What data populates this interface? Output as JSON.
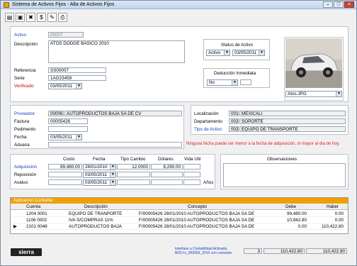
{
  "window": {
    "title": "Sistema de Activos Fijos - Alta de Activos Fijos"
  },
  "toolbar": {
    "icons": [
      "new-icon",
      "save-icon",
      "delete-icon",
      "money-icon",
      "edit-icon",
      "print-icon"
    ]
  },
  "asset": {
    "activo_label": "Activo",
    "activo_value": "00007",
    "descripcion_label": "Descripción",
    "descripcion_value": "ATOS DODGE BASICO 2010",
    "referencia_label": "Referencia",
    "referencia_value": "SS00007",
    "serie_label": "Serie",
    "serie_value": "1AG23459",
    "verificado_label": "Verificado",
    "verificado_value": "03/05/2011"
  },
  "status": {
    "title": "Status de Activo",
    "value": "Activo",
    "date": "03/05/2011"
  },
  "deduccion": {
    "title": "Deducción Inmediata",
    "value": "No"
  },
  "photo": {
    "file": "Atos.JPG"
  },
  "proveedor": {
    "proveedor_label": "Proveedor",
    "proveedor_code": "00006",
    "proveedor_name": "AUTOPRODUCTOS BAJA SA DE CV",
    "factura_label": "Factura",
    "factura_value": "00005426",
    "pedimento_label": "Pedimento",
    "pedimento_value": "",
    "fecha_label": "Fecha",
    "fecha_value": "03/05/2011",
    "aduana_label": "Aduana",
    "aduana_value": ""
  },
  "location": {
    "localizacion_label": "Localización",
    "localizacion_code": "001",
    "localizacion_name": "MEXICALI",
    "departamento_label": "Departamento",
    "departamento_code": "002",
    "departamento_name": "SOPORTE",
    "tipo_label": "Tipo de Activo",
    "tipo_code": "002",
    "tipo_name": "EQUIPO DE TRANSPORTE"
  },
  "warning": "Ninguna fecha puede ser menor a la fecha de adquisición, ni mayor al dia de hoy.",
  "costs": {
    "headers": [
      "Costo",
      "Fecha",
      "Tipo Cambio",
      "Dólares",
      "Vida Util"
    ],
    "adquisicion_label": "Adquisición",
    "adquisicion_costo": "99,480.00",
    "adquisicion_fecha": "28/01/2010",
    "adquisicion_tc": "12.0000",
    "adquisicion_dolares": "8,290.00",
    "reposicion_label": "Reposición",
    "reposicion_fecha": "03/05/2011",
    "avaluo_label": "Avaluo",
    "avaluo_fecha": "03/05/2011",
    "anos_label": "Años"
  },
  "observaciones": {
    "title": "Observaciones"
  },
  "grid": {
    "title": "Aplicación Contable",
    "headers": [
      "Cuenta",
      "Descripción",
      "Concepto",
      "Debe",
      "Haber"
    ],
    "rows": [
      {
        "cuenta": "1204 0001",
        "descripcion": "EQUIPO DE TRANPORTE",
        "concepto": "F/00005426  28/01/2010  AUTOPRODUCTOS BAJA SA DE",
        "debe": "99,480.00",
        "haber": "0.00"
      },
      {
        "cuenta": "1106 0002",
        "descripcion": "IVA S/COMPRAS 11%",
        "concepto": "F/00005426  28/01/2010  AUTOPRODUCTOS BAJA SA DE",
        "debe": "10,942.80",
        "haber": "0.00"
      },
      {
        "cuenta": "2101 0048",
        "descripcion": "AUTOPRODUCTOS BAJA",
        "concepto": "F/00005426  28/01/2010  AUTOPRODUCTOS BAJA SA DE",
        "debe": "0.00",
        "haber": "110,422.80"
      }
    ]
  },
  "footer": {
    "logo": "sierra",
    "info": "Interfase a Contabilidad Activada. BDC=c_000069_2010 con conexión.",
    "count": "3",
    "total_debe": "110,422.80",
    "total_haber": "110,422.80"
  }
}
